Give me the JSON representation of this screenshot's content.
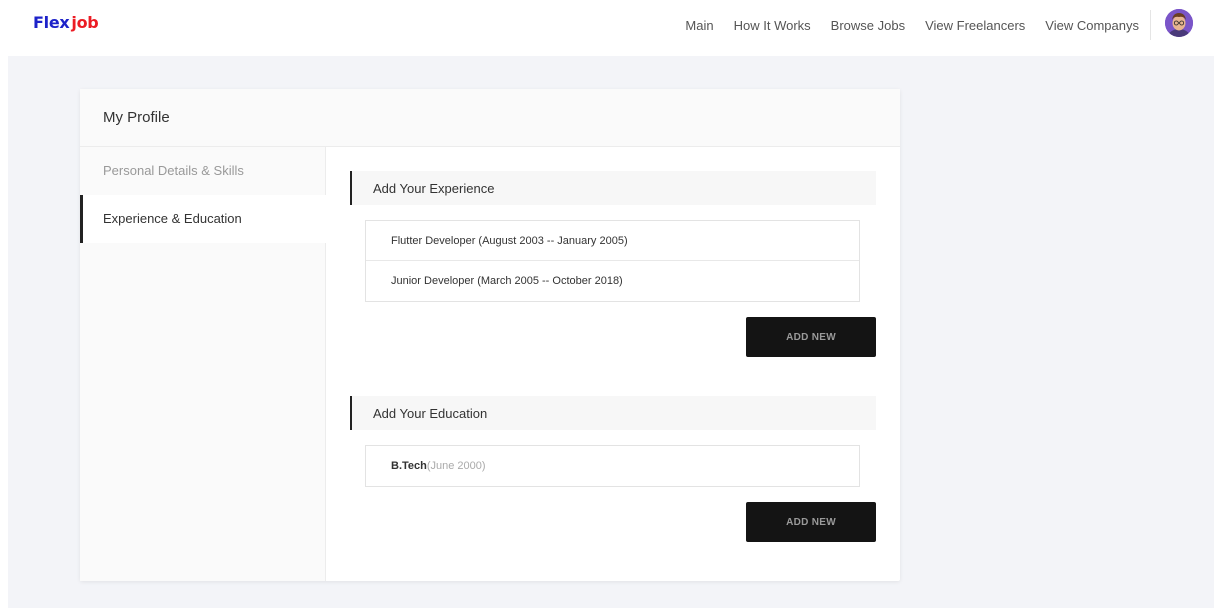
{
  "header": {
    "logo": {
      "part1": "Flex",
      "part2": "job",
      "color1": "#1d22c9",
      "color2": "#ec1c24"
    },
    "nav": [
      {
        "label": "Main"
      },
      {
        "label": "How It Works"
      },
      {
        "label": "Browse Jobs"
      },
      {
        "label": "View Freelancers"
      },
      {
        "label": "View Companys"
      }
    ],
    "avatar_icon": "user-avatar"
  },
  "profile": {
    "title": "My Profile",
    "sidebar": [
      {
        "label": "Personal Details & Skills",
        "active": false
      },
      {
        "label": "Experience & Education",
        "active": true
      }
    ],
    "experience": {
      "heading": "Add Your Experience",
      "items": [
        {
          "text": "Flutter Developer (August 2003 -- January 2005)"
        },
        {
          "text": "Junior Developer (March 2005 -- October 2018)"
        }
      ],
      "button": "ADD NEW"
    },
    "education": {
      "heading": "Add Your Education",
      "items": [
        {
          "degree": "B.Tech",
          "date": "(June 2000)"
        }
      ],
      "button": "ADD NEW"
    }
  }
}
